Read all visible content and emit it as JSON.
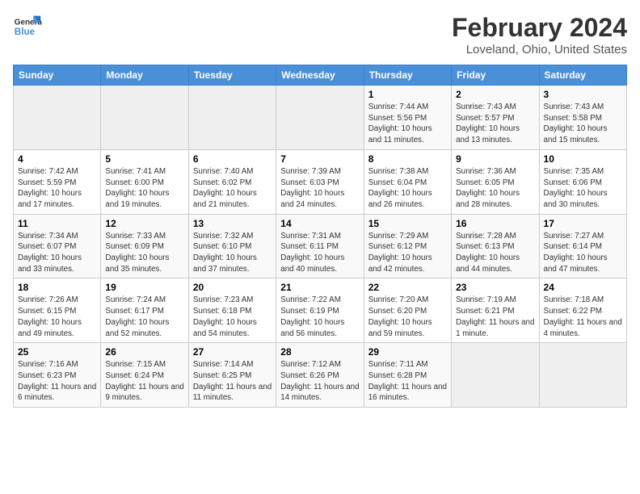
{
  "header": {
    "logo_line1": "General",
    "logo_line2": "Blue",
    "title": "February 2024",
    "subtitle": "Loveland, Ohio, United States"
  },
  "days_of_week": [
    "Sunday",
    "Monday",
    "Tuesday",
    "Wednesday",
    "Thursday",
    "Friday",
    "Saturday"
  ],
  "weeks": [
    [
      {
        "day": "",
        "info": "",
        "empty": true
      },
      {
        "day": "",
        "info": "",
        "empty": true
      },
      {
        "day": "",
        "info": "",
        "empty": true
      },
      {
        "day": "",
        "info": "",
        "empty": true
      },
      {
        "day": "1",
        "info": "Sunrise: 7:44 AM\nSunset: 5:56 PM\nDaylight: 10 hours and 11 minutes."
      },
      {
        "day": "2",
        "info": "Sunrise: 7:43 AM\nSunset: 5:57 PM\nDaylight: 10 hours and 13 minutes."
      },
      {
        "day": "3",
        "info": "Sunrise: 7:43 AM\nSunset: 5:58 PM\nDaylight: 10 hours and 15 minutes."
      }
    ],
    [
      {
        "day": "4",
        "info": "Sunrise: 7:42 AM\nSunset: 5:59 PM\nDaylight: 10 hours and 17 minutes."
      },
      {
        "day": "5",
        "info": "Sunrise: 7:41 AM\nSunset: 6:00 PM\nDaylight: 10 hours and 19 minutes."
      },
      {
        "day": "6",
        "info": "Sunrise: 7:40 AM\nSunset: 6:02 PM\nDaylight: 10 hours and 21 minutes."
      },
      {
        "day": "7",
        "info": "Sunrise: 7:39 AM\nSunset: 6:03 PM\nDaylight: 10 hours and 24 minutes."
      },
      {
        "day": "8",
        "info": "Sunrise: 7:38 AM\nSunset: 6:04 PM\nDaylight: 10 hours and 26 minutes."
      },
      {
        "day": "9",
        "info": "Sunrise: 7:36 AM\nSunset: 6:05 PM\nDaylight: 10 hours and 28 minutes."
      },
      {
        "day": "10",
        "info": "Sunrise: 7:35 AM\nSunset: 6:06 PM\nDaylight: 10 hours and 30 minutes."
      }
    ],
    [
      {
        "day": "11",
        "info": "Sunrise: 7:34 AM\nSunset: 6:07 PM\nDaylight: 10 hours and 33 minutes."
      },
      {
        "day": "12",
        "info": "Sunrise: 7:33 AM\nSunset: 6:09 PM\nDaylight: 10 hours and 35 minutes."
      },
      {
        "day": "13",
        "info": "Sunrise: 7:32 AM\nSunset: 6:10 PM\nDaylight: 10 hours and 37 minutes."
      },
      {
        "day": "14",
        "info": "Sunrise: 7:31 AM\nSunset: 6:11 PM\nDaylight: 10 hours and 40 minutes."
      },
      {
        "day": "15",
        "info": "Sunrise: 7:29 AM\nSunset: 6:12 PM\nDaylight: 10 hours and 42 minutes."
      },
      {
        "day": "16",
        "info": "Sunrise: 7:28 AM\nSunset: 6:13 PM\nDaylight: 10 hours and 44 minutes."
      },
      {
        "day": "17",
        "info": "Sunrise: 7:27 AM\nSunset: 6:14 PM\nDaylight: 10 hours and 47 minutes."
      }
    ],
    [
      {
        "day": "18",
        "info": "Sunrise: 7:26 AM\nSunset: 6:15 PM\nDaylight: 10 hours and 49 minutes."
      },
      {
        "day": "19",
        "info": "Sunrise: 7:24 AM\nSunset: 6:17 PM\nDaylight: 10 hours and 52 minutes."
      },
      {
        "day": "20",
        "info": "Sunrise: 7:23 AM\nSunset: 6:18 PM\nDaylight: 10 hours and 54 minutes."
      },
      {
        "day": "21",
        "info": "Sunrise: 7:22 AM\nSunset: 6:19 PM\nDaylight: 10 hours and 56 minutes."
      },
      {
        "day": "22",
        "info": "Sunrise: 7:20 AM\nSunset: 6:20 PM\nDaylight: 10 hours and 59 minutes."
      },
      {
        "day": "23",
        "info": "Sunrise: 7:19 AM\nSunset: 6:21 PM\nDaylight: 11 hours and 1 minute."
      },
      {
        "day": "24",
        "info": "Sunrise: 7:18 AM\nSunset: 6:22 PM\nDaylight: 11 hours and 4 minutes."
      }
    ],
    [
      {
        "day": "25",
        "info": "Sunrise: 7:16 AM\nSunset: 6:23 PM\nDaylight: 11 hours and 6 minutes."
      },
      {
        "day": "26",
        "info": "Sunrise: 7:15 AM\nSunset: 6:24 PM\nDaylight: 11 hours and 9 minutes."
      },
      {
        "day": "27",
        "info": "Sunrise: 7:14 AM\nSunset: 6:25 PM\nDaylight: 11 hours and 11 minutes."
      },
      {
        "day": "28",
        "info": "Sunrise: 7:12 AM\nSunset: 6:26 PM\nDaylight: 11 hours and 14 minutes."
      },
      {
        "day": "29",
        "info": "Sunrise: 7:11 AM\nSunset: 6:28 PM\nDaylight: 11 hours and 16 minutes."
      },
      {
        "day": "",
        "info": "",
        "empty": true
      },
      {
        "day": "",
        "info": "",
        "empty": true
      }
    ]
  ]
}
